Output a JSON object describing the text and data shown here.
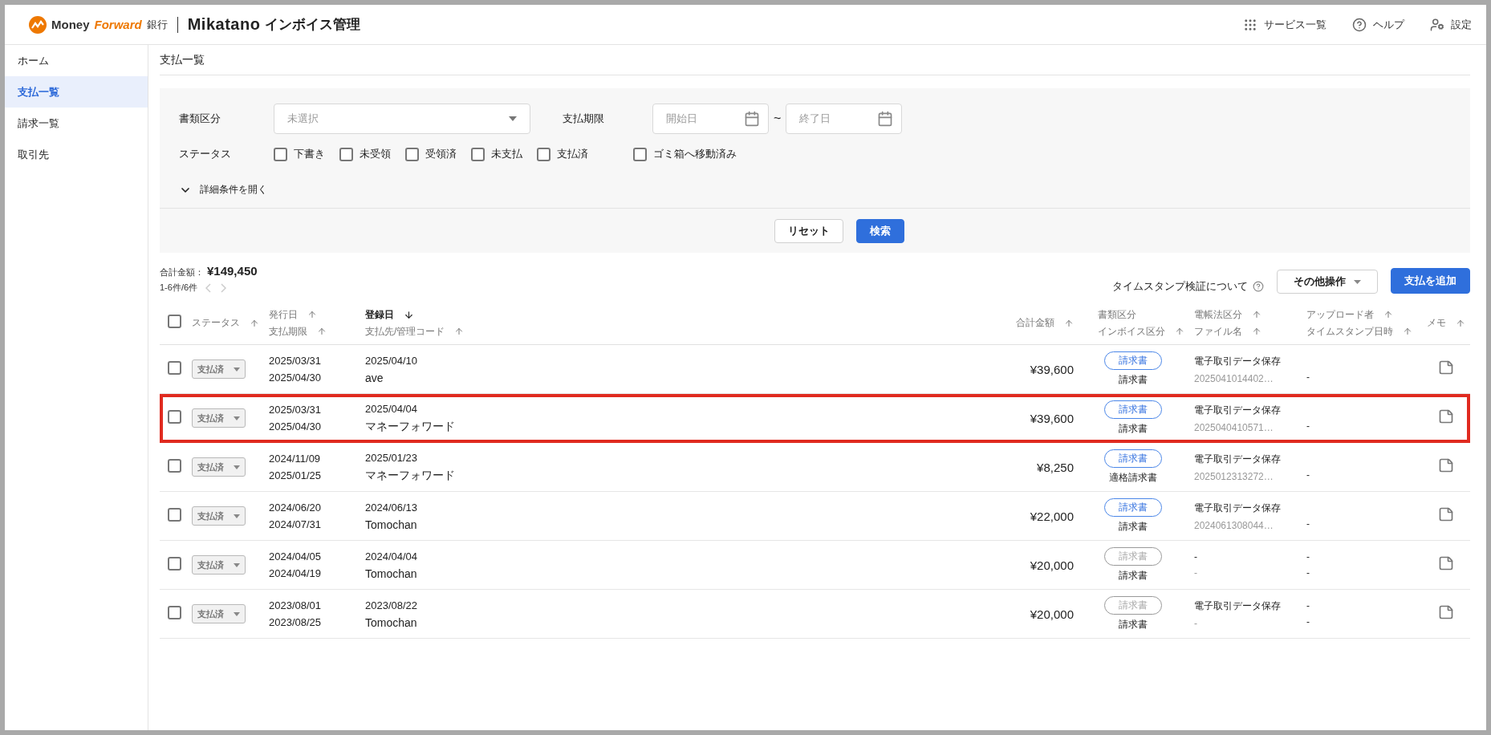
{
  "header": {
    "brand_first": "Money",
    "brand_second": "Forward",
    "brand_bank": "銀行",
    "product": "Mikatano",
    "product_suffix": "インボイス管理",
    "nav": [
      {
        "kind": "services",
        "label": "サービス一覧"
      },
      {
        "kind": "help",
        "label": "ヘルプ"
      },
      {
        "kind": "settings",
        "label": "設定"
      }
    ]
  },
  "sidebar": {
    "items": [
      {
        "label": "ホーム",
        "selected": false
      },
      {
        "label": "支払一覧",
        "selected": true
      },
      {
        "label": "請求一覧",
        "selected": false
      },
      {
        "label": "取引先",
        "selected": false
      }
    ]
  },
  "page_title": "支払一覧",
  "filters": {
    "document_type": {
      "label": "書類区分",
      "placeholder": "未選択"
    },
    "due": {
      "label": "支払期限",
      "start_placeholder": "開始日",
      "separator": "~",
      "end_placeholder": "終了日"
    },
    "status": {
      "label": "ステータス",
      "options": [
        {
          "label": "下書き",
          "checked": false
        },
        {
          "label": "未受領",
          "checked": false
        },
        {
          "label": "受領済",
          "checked": false
        },
        {
          "label": "未支払",
          "checked": false
        },
        {
          "label": "支払済",
          "checked": false
        },
        {
          "label": "ゴミ箱へ移動済み",
          "checked": false
        }
      ]
    },
    "details_toggle": "詳細条件を開く",
    "reset_button": "リセット",
    "search_button": "検索"
  },
  "summary": {
    "total_label": "合計金額：",
    "total": "¥149,450",
    "count": "1-6件/6件"
  },
  "toolbar": {
    "timestamp_link": "タイムスタンプ検証について",
    "other_button": "その他操作",
    "add_button": "支払を追加"
  },
  "table": {
    "select_all_checked": false,
    "columns": [
      {
        "lines": [
          {
            "text": "ステータス",
            "sortable": true,
            "active": false
          }
        ]
      },
      {
        "lines": [
          {
            "text": "発行日",
            "sortable": true,
            "active": false
          },
          {
            "text": "支払期限",
            "sortable": true,
            "active": false
          }
        ]
      },
      {
        "lines": [
          {
            "text": "登録日",
            "sortable": true,
            "active": true
          },
          {
            "text": "支払先/管理コード",
            "sortable": true,
            "active": false
          }
        ]
      },
      {
        "lines": [
          {
            "text": "合計金額",
            "sortable": true,
            "active": false
          }
        ]
      },
      {
        "lines": [
          {
            "text": "書類区分",
            "sortable": false,
            "active": false
          },
          {
            "text": "インボイス区分",
            "sortable": true,
            "active": false
          }
        ]
      },
      {
        "lines": [
          {
            "text": "電帳法区分",
            "sortable": true,
            "active": false
          },
          {
            "text": "ファイル名",
            "sortable": true,
            "active": false
          }
        ]
      },
      {
        "lines": [
          {
            "text": "アップロード者",
            "sortable": true,
            "active": false
          },
          {
            "text": "タイムスタンプ日時",
            "sortable": true,
            "active": false
          }
        ]
      },
      {
        "lines": [
          {
            "text": "メモ",
            "sortable": true,
            "active": false
          }
        ]
      }
    ],
    "rows": [
      {
        "checked": false,
        "highlighted": false,
        "status": "支払済",
        "issue_date": "2025/03/31",
        "due_date": "2025/04/30",
        "registered": "2025/04/10",
        "partner": "ave",
        "amount": "¥39,600",
        "doc_type": "請求書",
        "doc_type_active": true,
        "invoice_type": "請求書",
        "denchoho": "電子取引データ保存",
        "file_name": "2025041014402…",
        "timestamp": "-"
      },
      {
        "checked": false,
        "highlighted": true,
        "status": "支払済",
        "issue_date": "2025/03/31",
        "due_date": "2025/04/30",
        "registered": "2025/04/04",
        "partner": "マネーフォワード",
        "amount": "¥39,600",
        "doc_type": "請求書",
        "doc_type_active": true,
        "invoice_type": "請求書",
        "denchoho": "電子取引データ保存",
        "file_name": "2025040410571…",
        "timestamp": "-"
      },
      {
        "checked": false,
        "highlighted": false,
        "status": "支払済",
        "issue_date": "2024/11/09",
        "due_date": "2025/01/25",
        "registered": "2025/01/23",
        "partner": "マネーフォワード",
        "amount": "¥8,250",
        "doc_type": "請求書",
        "doc_type_active": true,
        "invoice_type": "適格請求書",
        "denchoho": "電子取引データ保存",
        "file_name": "2025012313272…",
        "timestamp": "-"
      },
      {
        "checked": false,
        "highlighted": false,
        "status": "支払済",
        "issue_date": "2024/06/20",
        "due_date": "2024/07/31",
        "registered": "2024/06/13",
        "partner": "Tomochan",
        "amount": "¥22,000",
        "doc_type": "請求書",
        "doc_type_active": true,
        "invoice_type": "請求書",
        "denchoho": "電子取引データ保存",
        "file_name": "2024061308044…",
        "timestamp": "-"
      },
      {
        "checked": false,
        "highlighted": false,
        "status": "支払済",
        "issue_date": "2024/04/05",
        "due_date": "2024/04/19",
        "registered": "2024/04/04",
        "partner": "Tomochan",
        "amount": "¥20,000",
        "doc_type": "請求書",
        "doc_type_active": false,
        "invoice_type": "請求書",
        "denchoho": "-",
        "file_name": "-",
        "uploader": "-",
        "timestamp": "-"
      },
      {
        "checked": false,
        "highlighted": false,
        "status": "支払済",
        "issue_date": "2023/08/01",
        "due_date": "2023/08/25",
        "registered": "2023/08/22",
        "partner": "Tomochan",
        "amount": "¥20,000",
        "doc_type": "請求書",
        "doc_type_active": false,
        "invoice_type": "請求書",
        "denchoho": "電子取引データ保存",
        "file_name": "-",
        "uploader": "-",
        "timestamp": "-"
      }
    ]
  }
}
